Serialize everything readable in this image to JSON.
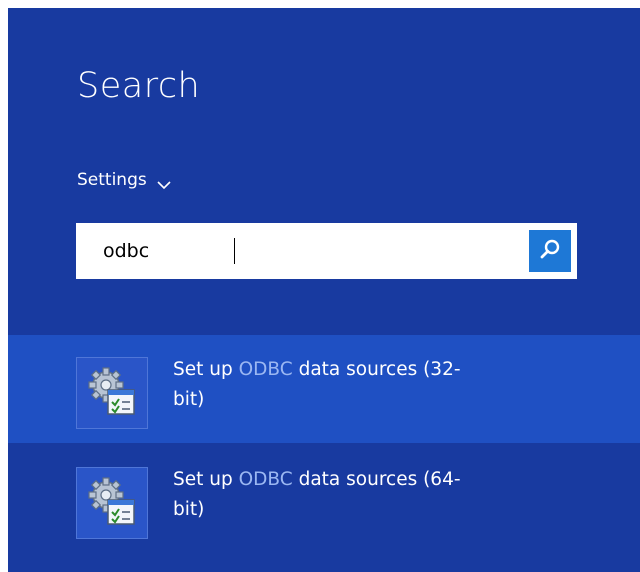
{
  "search": {
    "title": "Search",
    "scope_label": "Settings",
    "query": "odbc"
  },
  "results": [
    {
      "prefix": "Set up ",
      "highlight": "ODBC",
      "suffix_line1": " data sources (32-",
      "suffix_line2": "bit)",
      "selected": true,
      "icon": "odbc-settings-icon"
    },
    {
      "prefix": "Set up ",
      "highlight": "ODBC",
      "suffix_line1": " data sources (64-",
      "suffix_line2": "bit)",
      "selected": false,
      "icon": "odbc-settings-icon"
    }
  ],
  "colors": {
    "charm_background": "#183aa0",
    "selected_result": "#1f50c3",
    "search_button": "#1e78d6",
    "match_highlight": "#9bb7f2"
  }
}
